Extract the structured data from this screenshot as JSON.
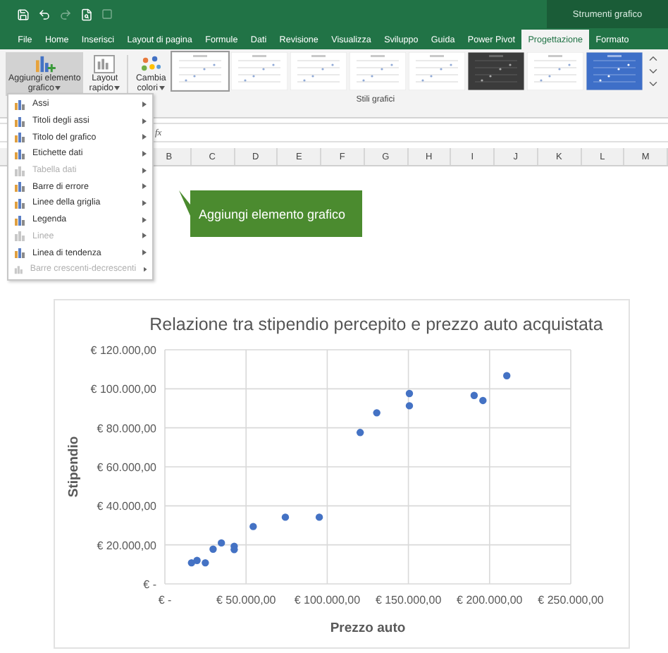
{
  "title_bar": {
    "context_label": "Strumenti grafico"
  },
  "tabs": [
    {
      "label": "File",
      "selected": false
    },
    {
      "label": "Home",
      "selected": false
    },
    {
      "label": "Inserisci",
      "selected": false
    },
    {
      "label": "Layout di pagina",
      "selected": false
    },
    {
      "label": "Formule",
      "selected": false
    },
    {
      "label": "Dati",
      "selected": false
    },
    {
      "label": "Revisione",
      "selected": false
    },
    {
      "label": "Visualizza",
      "selected": false
    },
    {
      "label": "Sviluppo",
      "selected": false
    },
    {
      "label": "Guida",
      "selected": false
    },
    {
      "label": "Power Pivot",
      "selected": false
    },
    {
      "label": "Progettazione",
      "selected": true
    },
    {
      "label": "Formato",
      "selected": false
    }
  ],
  "ribbon": {
    "buttons": [
      {
        "kind": "add-element",
        "lines": [
          "Aggiungi elemento",
          "grafico"
        ],
        "selected": true
      },
      {
        "kind": "layout",
        "lines": [
          "Layout",
          "rapido"
        ],
        "selected": false
      },
      {
        "kind": "colors",
        "lines": [
          "Cambia",
          "colori"
        ],
        "selected": false
      }
    ],
    "styles": [
      {
        "kind": "light",
        "selected": true
      },
      {
        "kind": "light",
        "selected": false
      },
      {
        "kind": "light",
        "selected": false
      },
      {
        "kind": "light",
        "selected": false
      },
      {
        "kind": "light",
        "selected": false
      },
      {
        "kind": "dark",
        "selected": false
      },
      {
        "kind": "light",
        "selected": false
      },
      {
        "kind": "blue",
        "selected": false
      }
    ],
    "styles_group_label": "Stili grafici"
  },
  "formula_bar": {
    "function_label": "fx"
  },
  "columns": [
    "B",
    "C",
    "D",
    "E",
    "F",
    "G",
    "H",
    "I",
    "J",
    "K",
    "L",
    "M"
  ],
  "menu": {
    "items": [
      {
        "label": "Assi",
        "disabled": false
      },
      {
        "label": "Titoli degli assi",
        "disabled": false
      },
      {
        "label": "Titolo del grafico",
        "disabled": false
      },
      {
        "label": "Etichette dati",
        "disabled": false
      },
      {
        "label": "Tabella dati",
        "disabled": true
      },
      {
        "label": "Barre di errore",
        "disabled": false
      },
      {
        "label": "Linee della griglia",
        "disabled": false
      },
      {
        "label": "Legenda",
        "disabled": false
      },
      {
        "label": "Linee",
        "disabled": true
      },
      {
        "label": "Linea di tendenza",
        "disabled": false
      },
      {
        "label": "Barre crescenti-decrescenti",
        "disabled": true
      }
    ]
  },
  "callout": {
    "text": "Aggiungi elemento grafico"
  },
  "chart": {
    "chart_data": {
      "type": "scatter",
      "grid": true,
      "title": "Relazione tra stipendio percepito e prezzo auto acquistata",
      "xlabel": "Prezzo auto",
      "ylabel": "Stipendio",
      "x": [
        16400,
        19800,
        24900,
        29700,
        34800,
        42700,
        42700,
        54400,
        74200,
        95100,
        120300,
        130500,
        150600,
        150600,
        190500,
        195900,
        210600
      ],
      "series": [
        {
          "color": "#4472c4",
          "values": [
            10800,
            12000,
            10800,
            17800,
            21000,
            19300,
            17600,
            29400,
            34200,
            34200,
            77600,
            87700,
            97600,
            91300,
            96600,
            94000,
            106700
          ]
        }
      ],
      "xlim": [
        0,
        250000
      ],
      "ylim": [
        0,
        120000
      ],
      "xticks": [
        {
          "value": 0,
          "label": "€ -"
        },
        {
          "value": 50000,
          "label": "€ 50.000,00"
        },
        {
          "value": 100000,
          "label": "€ 100.000,00"
        },
        {
          "value": 150000,
          "label": "€ 150.000,00"
        },
        {
          "value": 200000,
          "label": "€ 200.000,00"
        },
        {
          "value": 250000,
          "label": "€ 250.000,00"
        }
      ],
      "yticks": [
        {
          "value": 0,
          "label": "€ -"
        },
        {
          "value": 20000,
          "label": "€ 20.000,00"
        },
        {
          "value": 40000,
          "label": "€ 40.000,00"
        },
        {
          "value": 60000,
          "label": "€ 60.000,00"
        },
        {
          "value": 80000,
          "label": "€ 80.000,00"
        },
        {
          "value": 100000,
          "label": "€ 100.000,00"
        },
        {
          "value": 120000,
          "label": "€ 120.000,00"
        }
      ]
    }
  }
}
